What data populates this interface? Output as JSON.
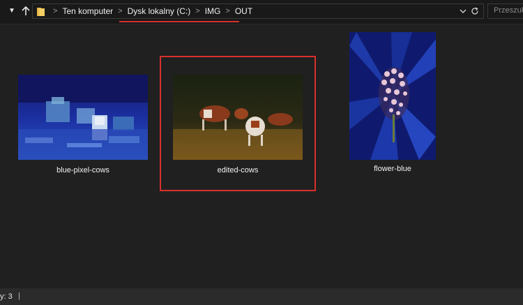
{
  "address_bar": {
    "breadcrumbs": [
      {
        "label": "Ten komputer"
      },
      {
        "label": "Dysk lokalny (C:)"
      },
      {
        "label": "IMG"
      },
      {
        "label": "OUT"
      }
    ],
    "separator": ">",
    "dropdown_icon": "chevron-down-icon",
    "refresh_icon": "refresh-icon"
  },
  "navigation": {
    "recent_icon": "chevron-down-icon",
    "up_icon": "arrow-up-icon"
  },
  "search": {
    "placeholder": "Przeszuk"
  },
  "files": [
    {
      "name": "blue-pixel-cows"
    },
    {
      "name": "edited-cows"
    },
    {
      "name": "flower-blue"
    }
  ],
  "selected_file": "edited-cows",
  "status_bar": {
    "text": "y: 3",
    "separator": "|"
  },
  "colors": {
    "highlight": "#d9302c",
    "background": "#202020",
    "toolbar": "#191919",
    "statusbar": "#2b2b2b"
  }
}
